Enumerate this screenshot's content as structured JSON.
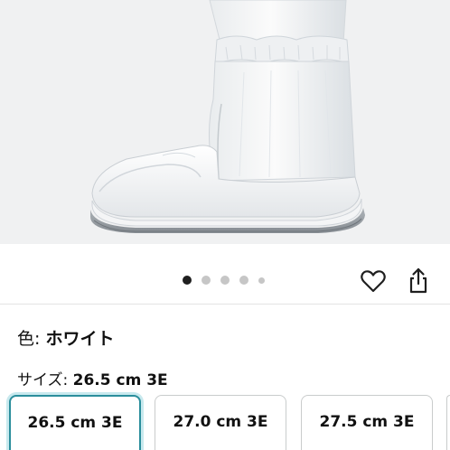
{
  "product": {
    "image_label": "boot-product-image",
    "carousel": {
      "page_count": 5,
      "current_index": 0
    }
  },
  "actions": {
    "favorite_icon": "heart-outline-icon",
    "share_icon": "share-icon"
  },
  "color": {
    "label": "色: ",
    "value": "ホワイト"
  },
  "size": {
    "label": "サイズ: ",
    "value": "26.5 cm 3E",
    "options": [
      "26.5 cm 3E",
      "27.0 cm 3E",
      "27.5 cm 3E"
    ],
    "selected_index": 0
  },
  "colors": {
    "accent": "#2a8e9c",
    "accent_glow": "#c8e9ee",
    "text": "#111111",
    "image_bg": "#f0f1f2"
  }
}
